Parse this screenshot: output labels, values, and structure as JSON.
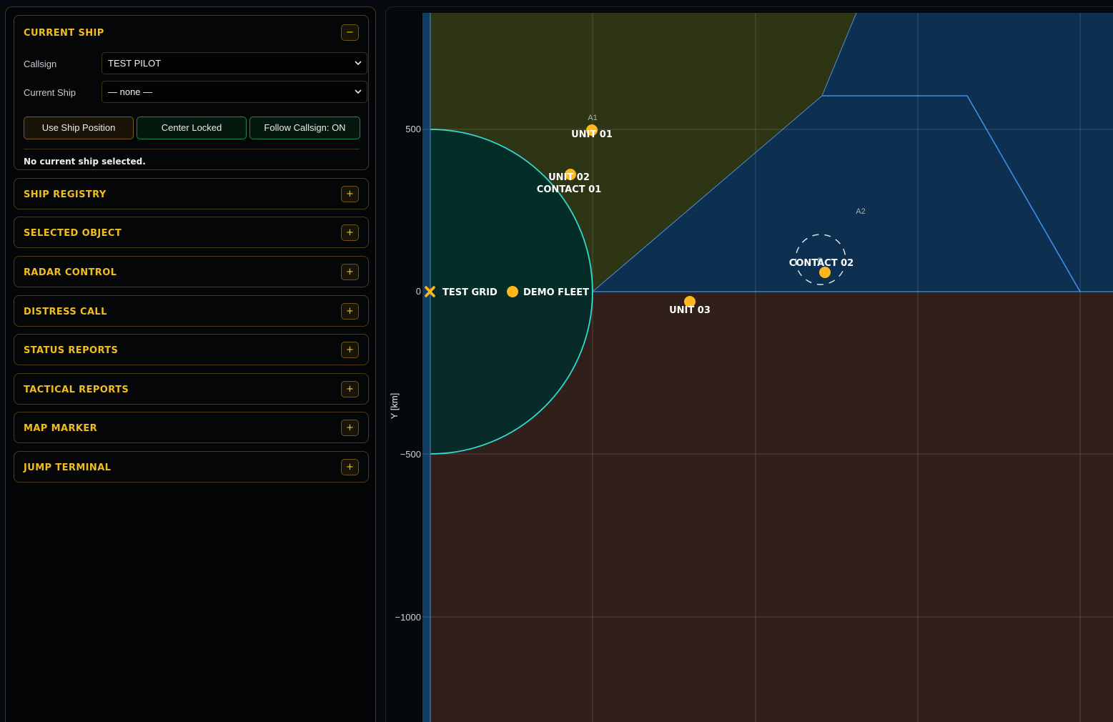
{
  "colors": {
    "accent": "#f2be1e",
    "marker": "#ffb81c",
    "zone_a1": "#2e3514",
    "zone_a2": "#0e3050",
    "zone_south": "#311f1b",
    "radar_ring": "#2fd9cf",
    "zone_a2_edge": "#3b8eea"
  },
  "sidebar": {
    "current_ship": {
      "title": "CURRENT SHIP",
      "toggle": "−",
      "callsign_label": "Callsign",
      "callsign_value": "TEST PILOT",
      "ship_label": "Current Ship",
      "ship_value": "— none —",
      "buttons": {
        "use_position": "Use Ship Position",
        "center_locked": "Center Locked",
        "follow_callsign": "Follow Callsign: ON"
      },
      "status": "No current ship selected."
    },
    "sections": [
      {
        "title": "SHIP REGISTRY",
        "toggle": "+"
      },
      {
        "title": "SELECTED OBJECT",
        "toggle": "+"
      },
      {
        "title": "RADAR CONTROL",
        "toggle": "+"
      },
      {
        "title": "DISTRESS CALL",
        "toggle": "+"
      },
      {
        "title": "STATUS REPORTS",
        "toggle": "+"
      },
      {
        "title": "TACTICAL REPORTS",
        "toggle": "+"
      },
      {
        "title": "MAP MARKER",
        "toggle": "+"
      },
      {
        "title": "JUMP TERMINAL",
        "toggle": "+"
      }
    ]
  },
  "map": {
    "y_axis_title": "Y [km]",
    "y_ticks": [
      "500",
      "0",
      "−500",
      "−1000"
    ],
    "zones": [
      {
        "label": "A1",
        "icon": "zone-a1-area"
      },
      {
        "label": "A2",
        "icon": "zone-a2-area"
      }
    ],
    "objects": {
      "unit_01": "UNIT 01",
      "unit_02": "UNIT 02",
      "contact_01": "CONTACT 01",
      "contact_02": "CONTACT 02",
      "unit_03": "UNIT 03",
      "test_grid": "TEST GRID",
      "demo_fleet": "DEMO FLEET"
    }
  }
}
